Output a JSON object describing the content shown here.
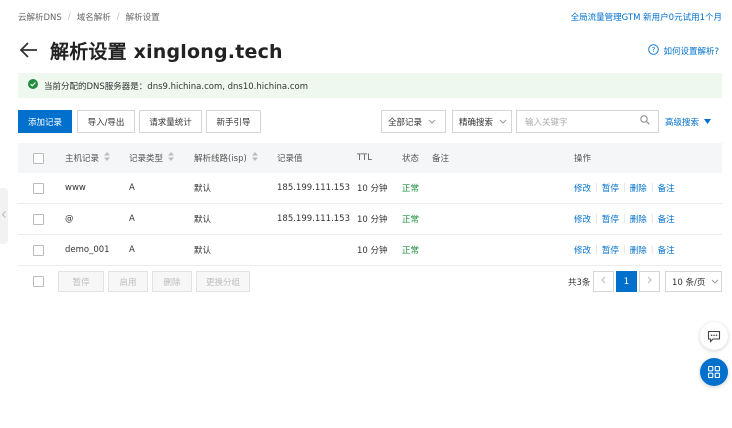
{
  "breadcrumb": [
    "云解析DNS",
    "域名解析",
    "解析设置"
  ],
  "promo_link": "全局流量管理GTM 新用户0元试用1个月",
  "title": "解析设置 xinglong.tech",
  "help_link": "如何设置解析?",
  "notice": "当前分配的DNS服务器是：dns9.hichina.com, dns10.hichina.com",
  "toolbar": {
    "add_record": "添加记录",
    "import_export": "导入/导出",
    "request_stats": "请求量统计",
    "newbie_guide": "新手引导",
    "all_records": "全部记录",
    "exact_search": "精确搜索",
    "search_placeholder": "输入关键字",
    "advanced_search": "高级搜索"
  },
  "columns": {
    "host": "主机记录",
    "type": "记录类型",
    "line": "解析线路(isp)",
    "value": "记录值",
    "ttl": "TTL",
    "status": "状态",
    "remark": "备注",
    "actions": "操作"
  },
  "rows": [
    {
      "host": "www",
      "type": "A",
      "line": "默认",
      "value": "185.199.111.153",
      "ttl": "10 分钟",
      "status": "正常"
    },
    {
      "host": "@",
      "type": "A",
      "line": "默认",
      "value": "185.199.111.153",
      "ttl": "10 分钟",
      "status": "正常"
    },
    {
      "host": "demo_001",
      "type": "A",
      "line": "默认",
      "value": "",
      "ttl": "10 分钟",
      "status": "正常"
    }
  ],
  "row_actions": {
    "edit": "修改",
    "pause": "暂停",
    "delete": "删除",
    "remark": "备注"
  },
  "bulk": {
    "pause": "暂停",
    "enable": "启用",
    "delete": "删除",
    "change_group": "更换分组"
  },
  "pagination": {
    "total": "共3条",
    "current_page": "1",
    "page_size": "10 条/页"
  },
  "colors": {
    "accent": "#0070cc",
    "status_ok": "#1e8e3e",
    "notice_bg": "#eef8ef"
  },
  "icons": {
    "back": "arrow-left-icon",
    "help": "question-circle-icon",
    "notice": "check-circle-icon",
    "search": "search-icon",
    "chat": "chat-bubble-icon",
    "apps": "apps-grid-icon"
  }
}
